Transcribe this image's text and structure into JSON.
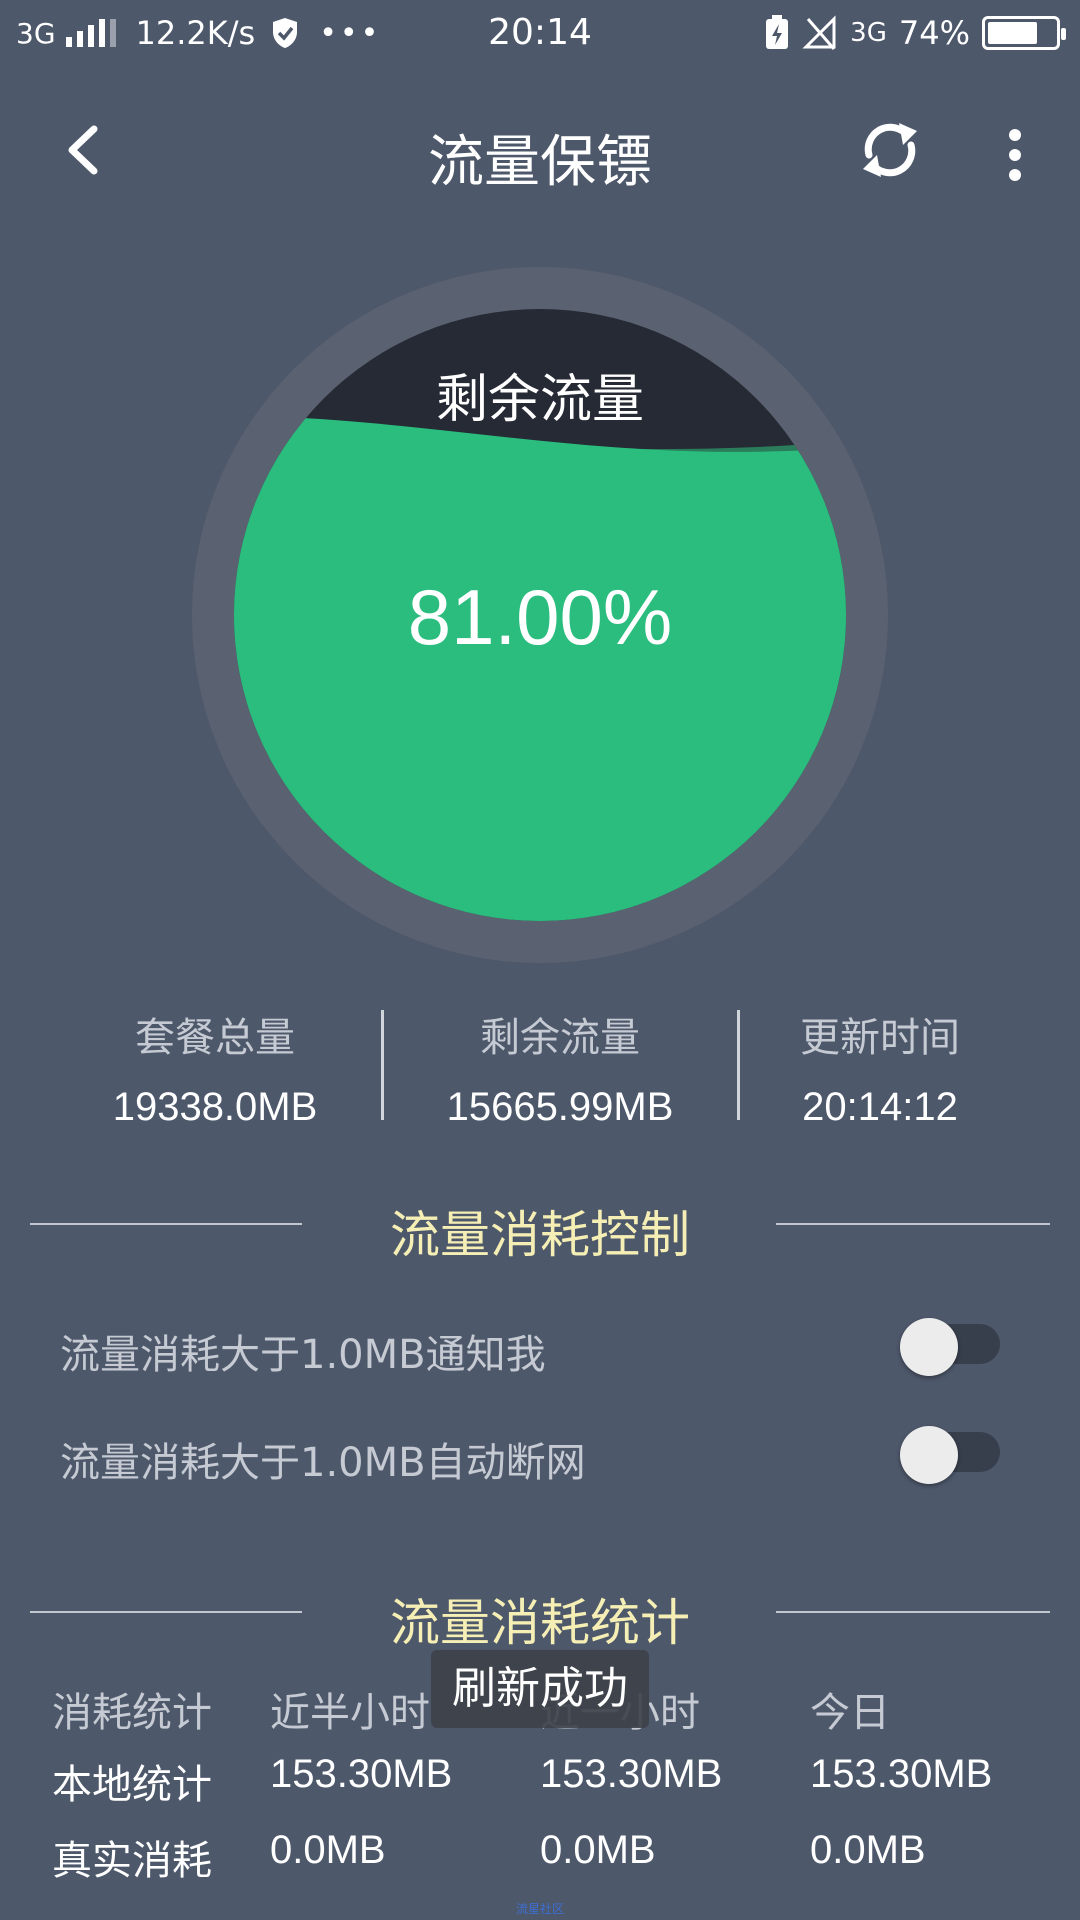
{
  "status_bar": {
    "network": "3G",
    "speed": "12.2K/s",
    "dots": "•••",
    "time": "20:14",
    "network_right": "3G",
    "battery_percent": "74%",
    "battery_level": 0.74
  },
  "header": {
    "title": "流量保镖"
  },
  "gauge": {
    "label": "剩余流量",
    "value_text": "81.00%",
    "fraction": 0.81,
    "fill_color": "#2bbd7e",
    "empty_color": "#252a34",
    "ring_color": "#5a6170"
  },
  "summary": {
    "total_label": "套餐总量",
    "total_value": "19338.0MB",
    "remaining_label": "剩余流量",
    "remaining_value": "15665.99MB",
    "update_label": "更新时间",
    "update_value": "20:14:12"
  },
  "control": {
    "title": "流量消耗控制",
    "notify_label": "流量消耗大于1.0MB通知我",
    "disconnect_label": "流量消耗大于1.0MB自动断网"
  },
  "stats": {
    "title": "流量消耗统计",
    "headers": [
      "消耗统计",
      "近半小时",
      "近一小时",
      "今日"
    ],
    "rows": [
      [
        "本地统计",
        "153.30MB",
        "153.30MB",
        "153.30MB"
      ],
      [
        "真实消耗",
        "0.0MB",
        "0.0MB",
        "0.0MB"
      ]
    ]
  },
  "toast": {
    "message": "刷新成功"
  },
  "watermark": "流星社区",
  "colors": {
    "background": "#4e586b",
    "accent_title": "#f6efb5",
    "muted_text": "#c5cad3"
  }
}
